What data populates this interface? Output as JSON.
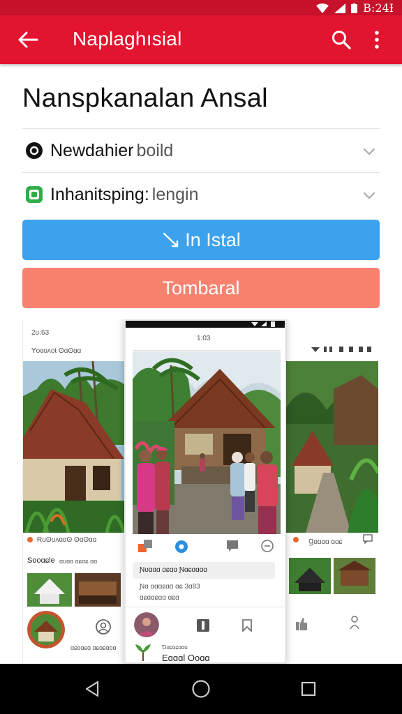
{
  "status_bar": {
    "time": "B:24Ɨ"
  },
  "app_bar": {
    "title": "Naplaghısial"
  },
  "page": {
    "title": "Nanspkanalan Ansal",
    "rows": [
      {
        "label": "Newdahier",
        "value": "boild"
      },
      {
        "label": "Inhanitsping:",
        "value": "lengin"
      }
    ],
    "install_label": "In Istal",
    "secondary_label": "Tombaral"
  },
  "screenshots": {
    "left": {
      "time": "2ʊ:63",
      "subtitle": "Ɏoɞoʌot ʘɑʘɑɑ",
      "card_title": "Ɍʊʘʊʌɑɑʘ ʘɑʘɑɑ",
      "section": "Sooɑɕle",
      "section_meta": "ɑʊɑɑ ɑɕɑɕ ɑɑ",
      "footer": "ɑɕɑɑɕɑ ɑɕɑɕɑɑɑ"
    },
    "center": {
      "time": "1:03",
      "card_line1": "Ɲʊɑɑɑ ɑɕɑɑ Ɲɑɕɑɑɑɑ",
      "card_line2": "Ɲɑ ɑɑɑɕɑɑ ɑɕ 3ɑ83",
      "card_line3": "ɑɕɑɑɕɑɑ ɑɕɑ",
      "footer_small": "Ɗɑɕɑɕɑɑɑ",
      "footer_title": "Eɑɑɑl Ooɑɑ"
    },
    "right": {
      "card_title": "Ɡɑɑɑɑ ɑɑɕ"
    }
  }
}
